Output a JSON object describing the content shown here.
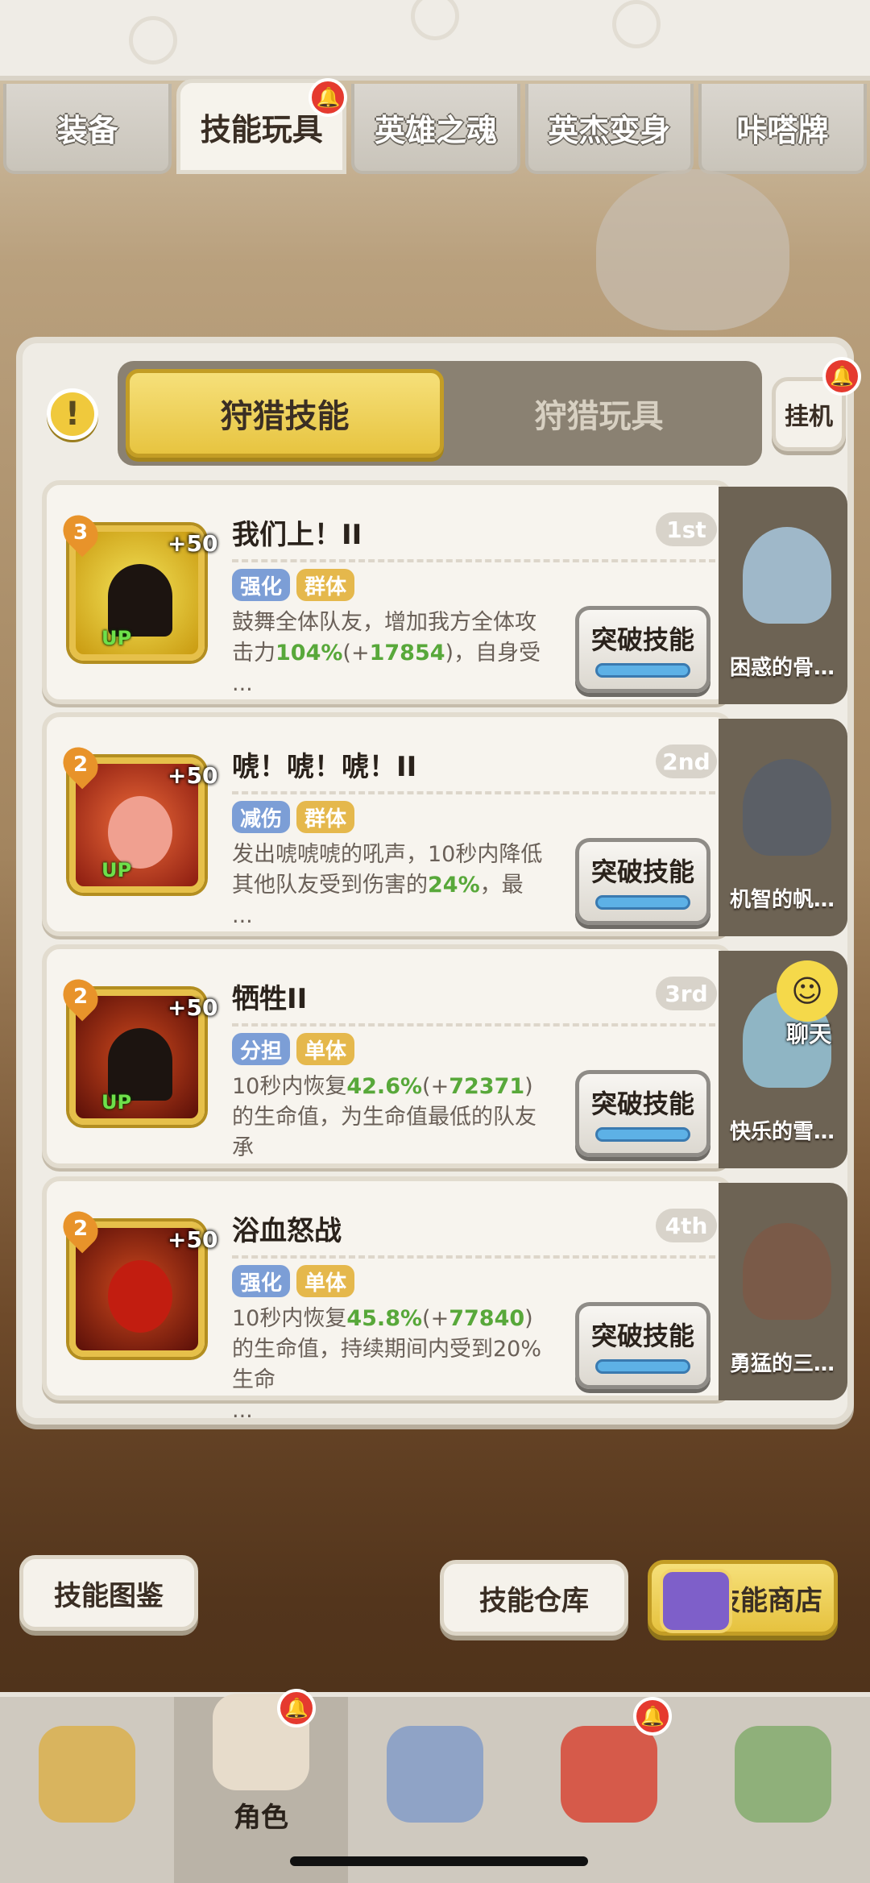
{
  "top_tabs": [
    {
      "label": "装备",
      "active": false,
      "badge": false
    },
    {
      "label": "技能玩具",
      "active": true,
      "badge": true
    },
    {
      "label": "英雄之魂",
      "active": false,
      "badge": false
    },
    {
      "label": "英杰变身",
      "active": false,
      "badge": false
    },
    {
      "label": "咔嗒牌",
      "active": false,
      "badge": false
    }
  ],
  "segment": {
    "left_label": "狩猎技能",
    "right_label": "狩猎玩具",
    "selected": "狩猎技能"
  },
  "idle_button_label": "挂机",
  "info_icon": "exclamation-icon",
  "skills": [
    {
      "name": "我们上！II",
      "rank": "1st",
      "level": "3",
      "plus": "+50",
      "up": "UP",
      "tags": [
        "强化",
        "群体"
      ],
      "desc_a": "鼓舞全体队友，增加我方全体攻击力",
      "desc_g1": "104%",
      "desc_b": "(+",
      "desc_g2": "17854",
      "desc_c": ")，自身受",
      "more": "...",
      "button": "突破技能",
      "hero": "困惑的骨…"
    },
    {
      "name": "唬！唬！唬！II",
      "rank": "2nd",
      "level": "2",
      "plus": "+50",
      "up": "UP",
      "tags": [
        "减伤",
        "群体"
      ],
      "desc_a": "发出唬唬唬的吼声，10秒内降低其他队友受到伤害的",
      "desc_g1": "24%",
      "desc_b": "，最",
      "desc_g2": "",
      "desc_c": "",
      "more": "...",
      "button": "突破技能",
      "hero": "机智的帆…"
    },
    {
      "name": "牺牲II",
      "rank": "3rd",
      "level": "2",
      "plus": "+50",
      "up": "UP",
      "tags": [
        "分担",
        "单体"
      ],
      "desc_a": "10秒内恢复",
      "desc_g1": "42.6%",
      "desc_b": "(+",
      "desc_g2": "72371",
      "desc_c": ")的生命值，为生命值最低的队友承",
      "more": "...",
      "button": "突破技能",
      "hero": "快乐的雪…"
    },
    {
      "name": "浴血怒战",
      "rank": "4th",
      "level": "2",
      "plus": "+50",
      "up": "",
      "tags": [
        "强化",
        "单体"
      ],
      "desc_a": "10秒内恢复",
      "desc_g1": "45.8%",
      "desc_b": "(+",
      "desc_g2": "77840",
      "desc_c": ")的生命值，持续期间内受到20%生命",
      "more": "...",
      "button": "突破技能",
      "hero": "勇猛的三…"
    }
  ],
  "chat_label": "聊天",
  "footer": {
    "codex": "技能图鉴",
    "warehouse": "技能仓库",
    "shop": "技能商店"
  },
  "nav": [
    {
      "name": "nav-hero-1",
      "label": "",
      "badge": false
    },
    {
      "name": "nav-character",
      "label": "角色",
      "badge": true
    },
    {
      "name": "nav-weapon",
      "label": "",
      "badge": false
    },
    {
      "name": "nav-pet",
      "label": "",
      "badge": true
    },
    {
      "name": "nav-totem",
      "label": "",
      "badge": false
    }
  ],
  "colors": {
    "accent_gold": "#e7c440",
    "highlight_green": "#58a83a",
    "tag_blue": "#7c9ed6",
    "tag_gold": "#e5b84c",
    "badge_red": "#e53a2f"
  }
}
